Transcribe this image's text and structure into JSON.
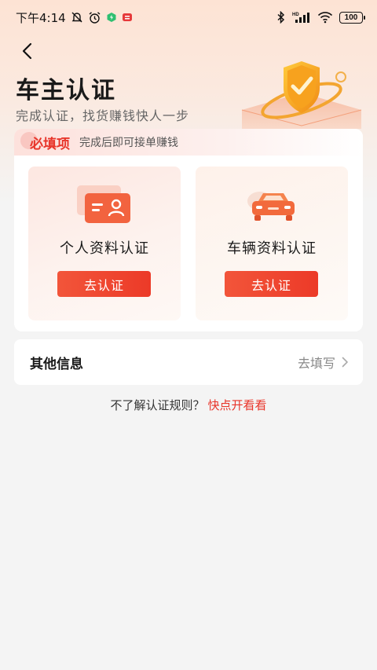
{
  "status_bar": {
    "time": "下午4:14",
    "battery": "100",
    "network_label": "HD"
  },
  "header": {
    "title": "车主认证",
    "subtitle": "完成认证，找货赚钱快人一步"
  },
  "required_section": {
    "title": "必填项",
    "hint": "完成后即可接单赚钱",
    "items": [
      {
        "label": "个人资料认证",
        "button": "去认证",
        "icon": "id-card-icon"
      },
      {
        "label": "车辆资料认证",
        "button": "去认证",
        "icon": "car-icon"
      }
    ]
  },
  "other_info": {
    "title": "其他信息",
    "action": "去填写"
  },
  "rules": {
    "question": "不了解认证规则？",
    "link": "快点开看看"
  },
  "colors": {
    "accent": "#e8352a",
    "button": "#ef4530",
    "background": "#f4f4f4"
  }
}
